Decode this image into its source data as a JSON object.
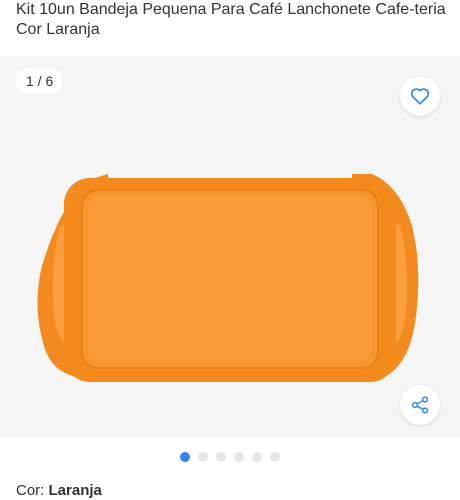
{
  "product": {
    "title": "Kit 10un Bandeja Pequena Para Café Lanchonete Cafe-teria Cor Laranja"
  },
  "gallery": {
    "counter": "1 / 6",
    "total_images": 6,
    "active_index": 0,
    "image_icon": "orange-tray-image",
    "favorite_icon": "heart-icon",
    "share_icon": "share-icon",
    "accent_color": "#3483fa",
    "tray_color": "#f7922a"
  },
  "variant": {
    "label": "Cor: ",
    "value": "Laranja"
  }
}
